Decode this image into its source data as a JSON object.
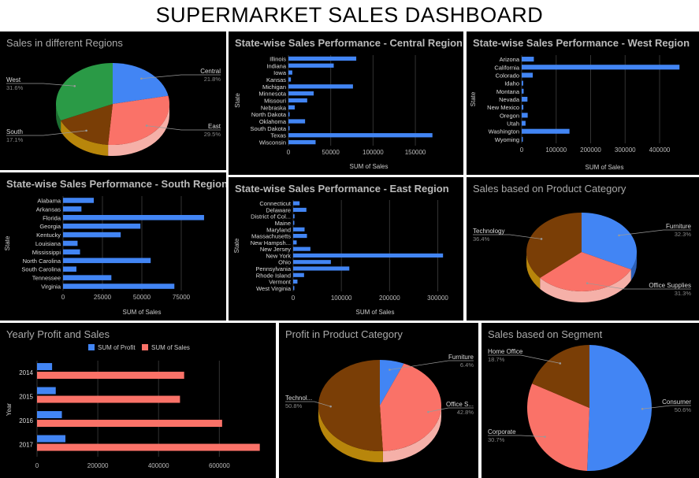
{
  "dashboard_title": "SUPERMARKET SALES DASHBOARD",
  "colors": {
    "blue": "#4285f4",
    "red": "#fa7268",
    "green": "#2a9a46",
    "brown": "#7a3e06"
  },
  "chart_data": [
    {
      "id": "regions",
      "type": "pie",
      "title": "Sales in different Regions",
      "slices": [
        {
          "label": "Central",
          "pct": "21.8%",
          "value": 21.8,
          "color": "#4285f4"
        },
        {
          "label": "East",
          "pct": "29.5%",
          "value": 29.5,
          "color": "#fa7268"
        },
        {
          "label": "South",
          "pct": "17.1%",
          "value": 17.1,
          "color": "#7a3e06"
        },
        {
          "label": "West",
          "pct": "31.6%",
          "value": 31.6,
          "color": "#2a9a46"
        }
      ]
    },
    {
      "id": "central",
      "type": "bar",
      "orientation": "horizontal",
      "title": "State-wise Sales Performance - Central Region",
      "xlabel": "SUM of Sales",
      "ylabel": "State",
      "categories": [
        "Illinois",
        "Indiana",
        "Iowa",
        "Kansas",
        "Michigan",
        "Minnesota",
        "Missouri",
        "Nebraska",
        "North Dakota",
        "Oklahoma",
        "South Dakota",
        "Texas",
        "Wisconsin"
      ],
      "values": [
        80166,
        53555,
        4580,
        2914,
        76270,
        29863,
        22205,
        7465,
        920,
        19683,
        1316,
        170188,
        32115
      ],
      "xticks": [
        0,
        50000,
        100000,
        150000
      ],
      "xlim": [
        0,
        190000
      ]
    },
    {
      "id": "west",
      "type": "bar",
      "orientation": "horizontal",
      "title": "State-wise Sales Performance - West Region",
      "xlabel": "SUM of Sales",
      "ylabel": "State",
      "categories": [
        "Arizona",
        "California",
        "Colorado",
        "Idaho",
        "Montana",
        "Nevada",
        "New Mexico",
        "Oregon",
        "Utah",
        "Washington",
        "Wyoming"
      ],
      "values": [
        35282,
        457688,
        32108,
        4382,
        5589,
        16729,
        4784,
        17431,
        11220,
        138641,
        1603
      ],
      "xticks": [
        0,
        100000,
        200000,
        300000,
        400000
      ],
      "xlim": [
        0,
        480000
      ]
    },
    {
      "id": "south",
      "type": "bar",
      "orientation": "horizontal",
      "title": "State-wise Sales Performance - South Region",
      "xlabel": "SUM of Sales",
      "ylabel": "State",
      "categories": [
        "Alabama",
        "Arkansas",
        "Florida",
        "Georgia",
        "Kentucky",
        "Louisiana",
        "Mississippi",
        "North Carolina",
        "South Carolina",
        "Tennessee",
        "Virginia"
      ],
      "values": [
        19511,
        11678,
        89474,
        49096,
        36592,
        9217,
        10771,
        55603,
        8482,
        30662,
        70637
      ],
      "xticks": [
        0,
        25000,
        50000,
        75000
      ],
      "xlim": [
        0,
        100000
      ]
    },
    {
      "id": "east",
      "type": "bar",
      "orientation": "horizontal",
      "title": "State-wise Sales Performance - East Region",
      "xlabel": "SUM of Sales",
      "ylabel": "State",
      "categories": [
        "Connecticut",
        "Delaware",
        "District of Col...",
        "Maine",
        "Maryland",
        "Massachusetts",
        "New Hampsh...",
        "New Jersey",
        "New York",
        "Ohio",
        "Pennsylvania",
        "Rhode Island",
        "Vermont",
        "West Virginia"
      ],
      "values": [
        13384,
        27451,
        2865,
        1271,
        23706,
        28634,
        7293,
        35764,
        310876,
        78258,
        116512,
        22628,
        8929,
        1209
      ],
      "xticks": [
        0,
        100000,
        200000,
        300000
      ],
      "xlim": [
        0,
        340000
      ]
    },
    {
      "id": "category_sales",
      "type": "pie",
      "title": "Sales based on Product Category",
      "slices": [
        {
          "label": "Furniture",
          "pct": "32.3%",
          "value": 32.3,
          "color": "#4285f4"
        },
        {
          "label": "Office Supplies",
          "pct": "31.3%",
          "value": 31.3,
          "color": "#fa7268"
        },
        {
          "label": "Technology",
          "pct": "36.4%",
          "value": 36.4,
          "color": "#7a3e06"
        }
      ]
    },
    {
      "id": "yearly",
      "type": "bar",
      "orientation": "horizontal",
      "title": "Yearly Profit and Sales",
      "xlabel": "",
      "ylabel": "Year",
      "categories": [
        "2014",
        "2015",
        "2016",
        "2017"
      ],
      "series": [
        {
          "name": "SUM of Profit",
          "values": [
            49544,
            61619,
            81795,
            93439
          ],
          "color": "#4285f4"
        },
        {
          "name": "SUM of Sales",
          "values": [
            484247,
            470533,
            609206,
            733215
          ],
          "color": "#fa7268"
        }
      ],
      "xticks": [
        0,
        200000,
        400000,
        600000
      ],
      "xlim": [
        0,
        760000
      ],
      "legend": "top"
    },
    {
      "id": "profit_category",
      "type": "pie",
      "title": "Profit in Product Category",
      "slices": [
        {
          "label": "Furniture",
          "pct": "6.4%",
          "value": 6.4,
          "color": "#4285f4"
        },
        {
          "label": "Office S...",
          "pct": "42.8%",
          "value": 42.8,
          "color": "#fa7268"
        },
        {
          "label": "Technol...",
          "pct": "50.8%",
          "value": 50.8,
          "color": "#7a3e06"
        }
      ]
    },
    {
      "id": "segment",
      "type": "pie",
      "title": "Sales based on Segment",
      "slices": [
        {
          "label": "Consumer",
          "pct": "50.6%",
          "value": 50.6,
          "color": "#4285f4"
        },
        {
          "label": "Corporate",
          "pct": "30.7%",
          "value": 30.7,
          "color": "#fa7268"
        },
        {
          "label": "Home Office",
          "pct": "18.7%",
          "value": 18.7,
          "color": "#7a3e06"
        }
      ]
    }
  ]
}
